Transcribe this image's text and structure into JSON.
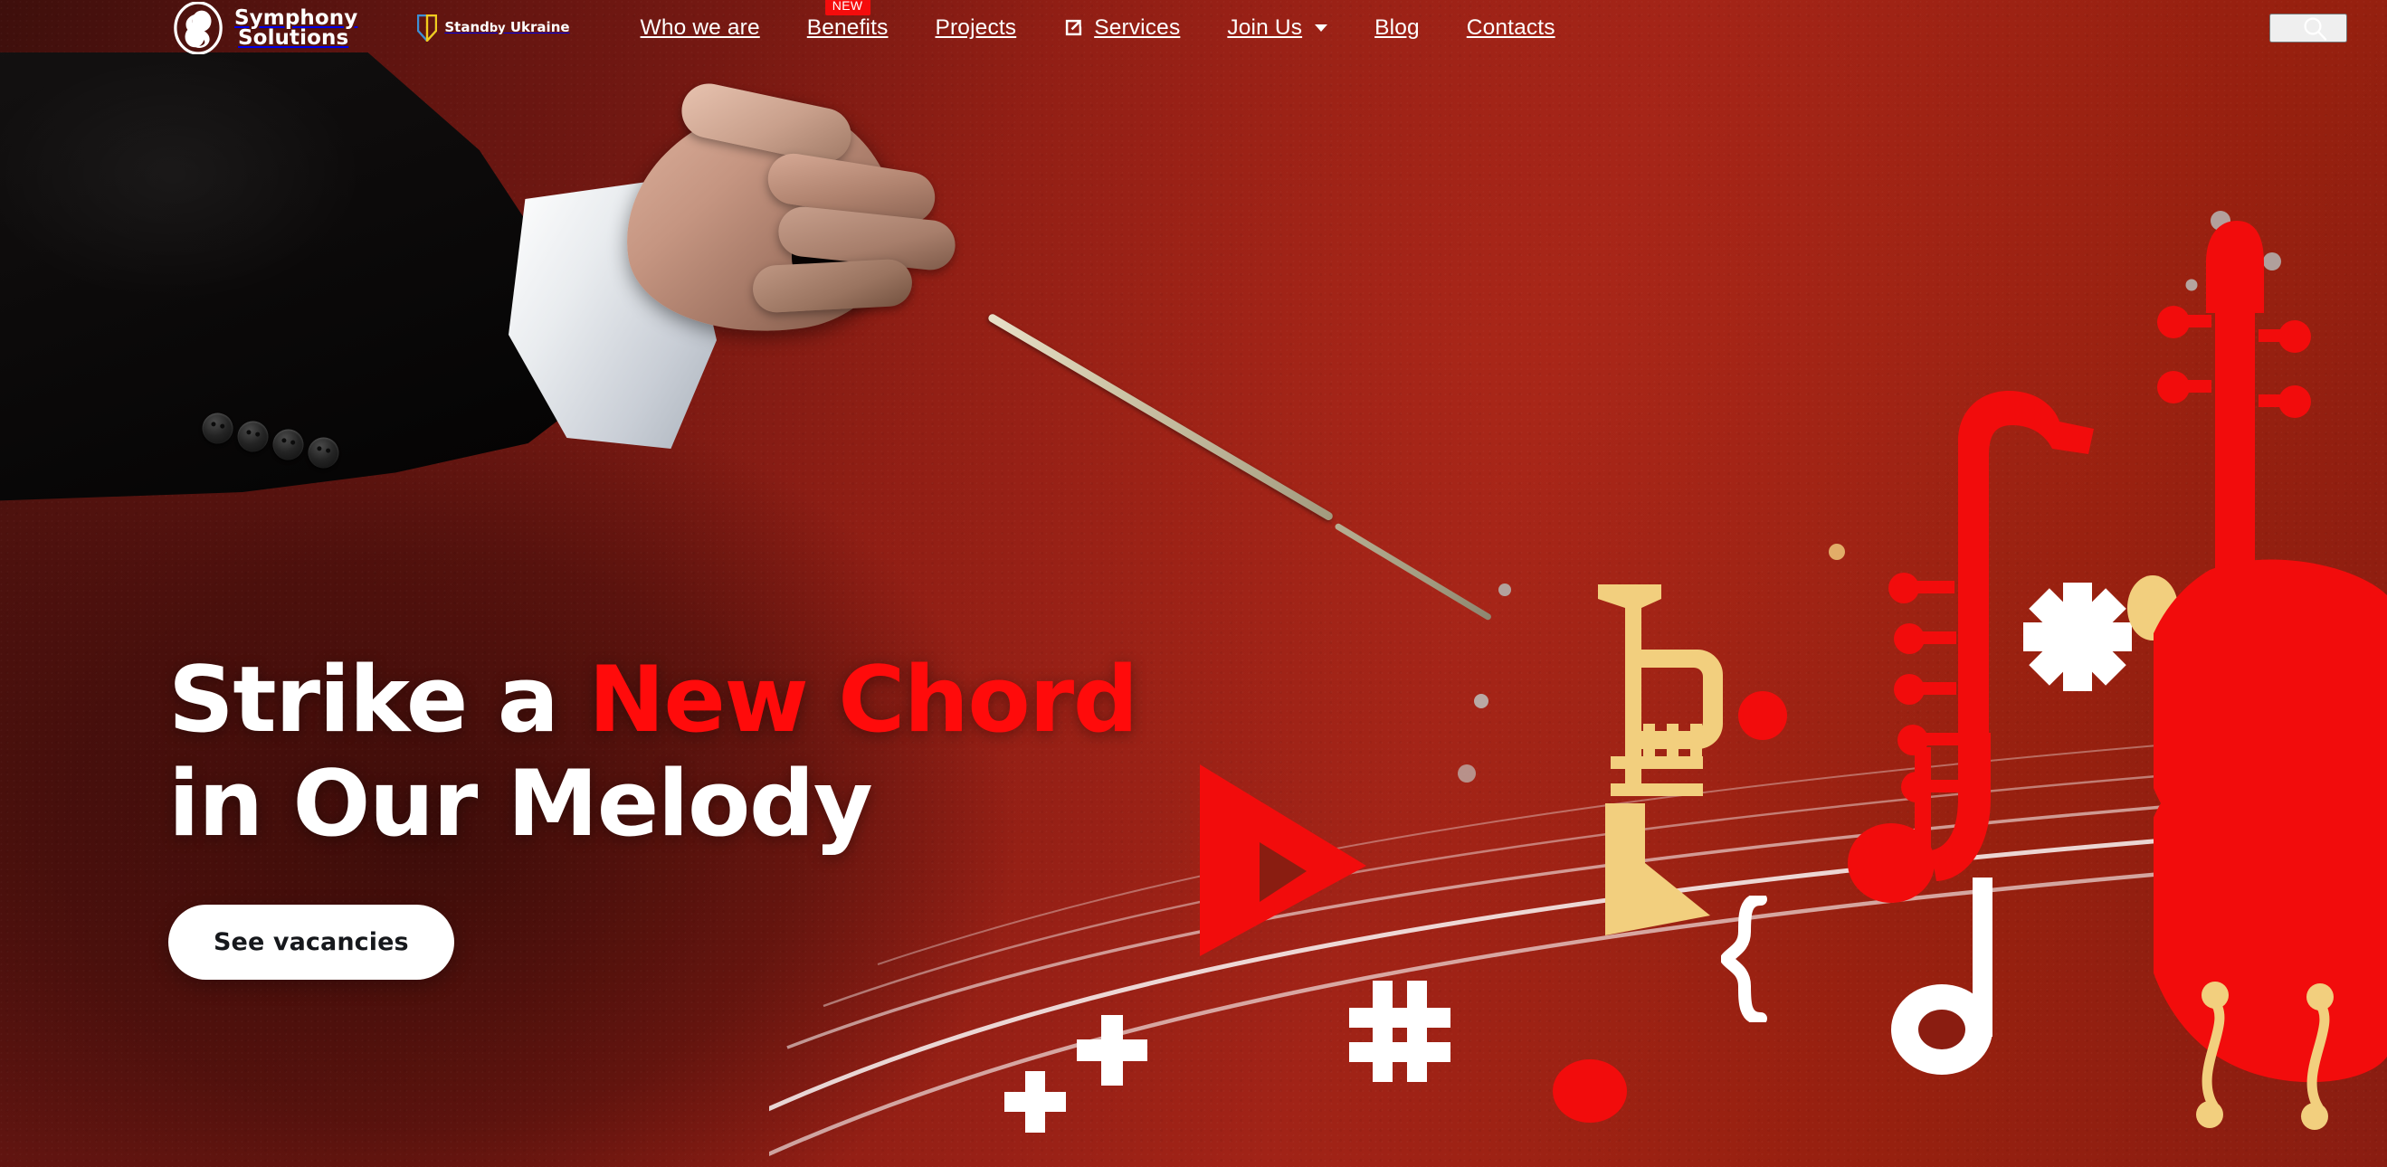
{
  "brand": {
    "logo_icon": "symphony-s-monogram-icon",
    "name_line1": "Symphony",
    "name_line2": "Solutions"
  },
  "ukraine_badge": {
    "icon": "ukraine-shield-icon",
    "line1": "Stand",
    "by": "by",
    "line2": "Ukraine",
    "shield_blue": "#3d8fd6",
    "shield_yellow": "#f2cb1c"
  },
  "nav": {
    "items": [
      {
        "label": "Who we are",
        "badge": null,
        "icon": null,
        "caret": false
      },
      {
        "label": "Benefits",
        "badge": "NEW",
        "icon": null,
        "caret": false
      },
      {
        "label": "Projects",
        "badge": null,
        "icon": null,
        "caret": false
      },
      {
        "label": "Services",
        "badge": null,
        "icon": "external-link-icon",
        "caret": false
      },
      {
        "label": "Join Us",
        "badge": null,
        "icon": null,
        "caret": true
      },
      {
        "label": "Blog",
        "badge": null,
        "icon": null,
        "caret": false
      },
      {
        "label": "Contacts",
        "badge": null,
        "icon": null,
        "caret": false
      }
    ],
    "search_icon": "search-icon",
    "badge_color": "#f50c0c"
  },
  "hero": {
    "headline_line1_plain": "Strike a ",
    "headline_line1_accent": "New Chord",
    "headline_line2": "in Our Melody",
    "cta_label": "See vacancies",
    "accent_color": "#ff0b0b",
    "background_color": "#8f1d14",
    "photo_subject": "conductor-hand-with-baton"
  },
  "decor": {
    "items": [
      "play-triangle-icon",
      "hash-icon",
      "plus-icon",
      "plus-icon",
      "curly-brace-icon",
      "asterisk-icon",
      "quarter-note-icon",
      "quarter-note-icon",
      "trumpet-icon",
      "saxophone-icon",
      "violin-icon",
      "cello-icon",
      "red-dot",
      "grey-dot",
      "yellow-dot",
      "staff-lines"
    ],
    "red": "#f50c0c",
    "gold": "#f2cf7e",
    "white": "#ffffff"
  }
}
